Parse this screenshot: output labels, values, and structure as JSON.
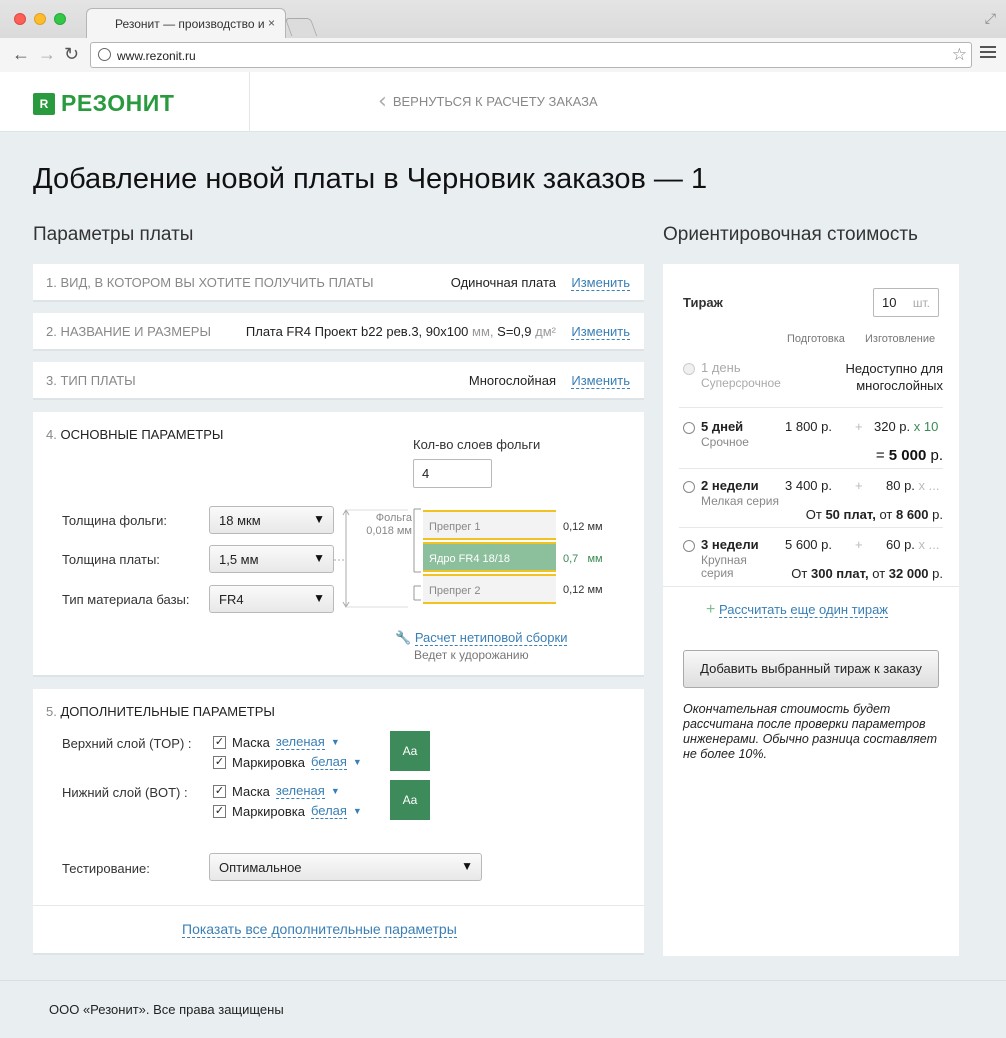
{
  "browser": {
    "tab_title": "Резонит — производство и",
    "tab_close": "×",
    "url": "www.rezonit.ru"
  },
  "header": {
    "logo_text": "РЕЗОНИТ",
    "logo_mark": "R",
    "back_link": "ВЕРНУТЬСЯ К РАСЧЕТУ ЗАКАЗА"
  },
  "page_title": "Добавление новой платы в Черновик заказов — 1",
  "params_title": "Параметры платы",
  "cost_title": "Ориентировочная стоимость",
  "change_label": "Изменить",
  "rows": {
    "view": {
      "label": "1. ВИД, В КОТОРОМ ВЫ ХОТИТЕ ПОЛУЧИТЬ ПЛАТЫ",
      "value": "Одиночная плата"
    },
    "name": {
      "label": "2. НАЗВАНИЕ И РАЗМЕРЫ",
      "value_main": "Плата FR4 Проект b22 рев.3, 90x100",
      "unit_mm": "мм,",
      "value_s": "S=0,9",
      "unit_dm": "дм²"
    },
    "type": {
      "label": "3. ТИП ПЛАТЫ",
      "value": "Многослойная"
    }
  },
  "basic": {
    "num": "4.",
    "title": "ОСНОВНЫЕ ПАРАМЕТРЫ",
    "layers_label": "Кол-во слоев фольги",
    "layers_value": "4",
    "foil_label": "Толщина фольги:",
    "foil_value": "18 мкм",
    "board_label": "Толщина платы:",
    "board_value": "1,5 мм",
    "material_label": "Тип материала базы:",
    "material_value": "FR4",
    "foil_note_1": "Фольга",
    "foil_note_2": "0,018 мм",
    "stack": [
      {
        "name": "Препрег 1",
        "thickness": "0,12 мм"
      },
      {
        "name": "Ядро FR4 18/18",
        "thickness": "0,7",
        "unit": "мм"
      },
      {
        "name": "Препрег 2",
        "thickness": "0,12 мм"
      }
    ],
    "custom_link": "Расчет нетиповой сборки",
    "custom_note": "Ведет к удорожанию"
  },
  "extra": {
    "num": "5.",
    "title": "ДОПОЛНИТЕЛЬНЫЕ ПАРАМЕТРЫ",
    "top_label": "Верхний слой (TOP) :",
    "bottom_label": "Нижний слой (BOT) :",
    "mask_label": "Маска",
    "mask_color": "зеленая",
    "marking_label": "Маркировка",
    "marking_color": "белая",
    "swatch_text": "Aa",
    "testing_label": "Тестирование:",
    "testing_value": "Оптимальное",
    "show_all": "Показать все дополнительные параметры",
    "check": "✓"
  },
  "cost": {
    "run_label": "Тираж",
    "run_value": "10",
    "run_unit": "шт.",
    "col_prep": "Подготовка",
    "col_make": "Изготовление",
    "options": [
      {
        "title": "1 день",
        "sub": "Суперсрочное",
        "status_1": "Недоступно для",
        "status_2": "многослойных"
      },
      {
        "title": "5 дней",
        "sub": "Срочное",
        "prep": "1 800 р.",
        "plus": "+",
        "make": "320 р.",
        "mult": "x 10",
        "total_prefix": "= ",
        "total": "5 000",
        "total_suffix": " р."
      },
      {
        "title": "2 недели",
        "sub": "Мелкая серия",
        "prep": "3 400 р.",
        "plus": "+",
        "make": "80 р.",
        "mult": "x ...",
        "from_1": "От ",
        "from_qty": "50 плат,",
        "from_2": " от ",
        "from_sum": "8 600",
        "from_3": " р."
      },
      {
        "title": "3 недели",
        "sub_1": "Крупная",
        "sub_2": "серия",
        "prep": "5 600 р.",
        "plus": "+",
        "make": "60 р.",
        "mult": "x ...",
        "from_1": "От ",
        "from_qty": "300 плат,",
        "from_2": " от ",
        "from_sum": "32 000",
        "from_3": " р."
      }
    ],
    "another_run": "Рассчитать еще один тираж",
    "another_plus": "+",
    "add_button": "Добавить выбранный тираж к заказу",
    "note": "Окончательная стоимость будет рассчитана после проверки параметров инженерами. Обычно разница составляет не более 10%."
  },
  "footer": "ООО «Резонит». Все права защищены",
  "colors": {
    "brand_green": "#2a9a3f",
    "link_blue": "#3a7fb5",
    "core_green": "#8cbf9c",
    "foil_yellow": "#f2c320"
  }
}
